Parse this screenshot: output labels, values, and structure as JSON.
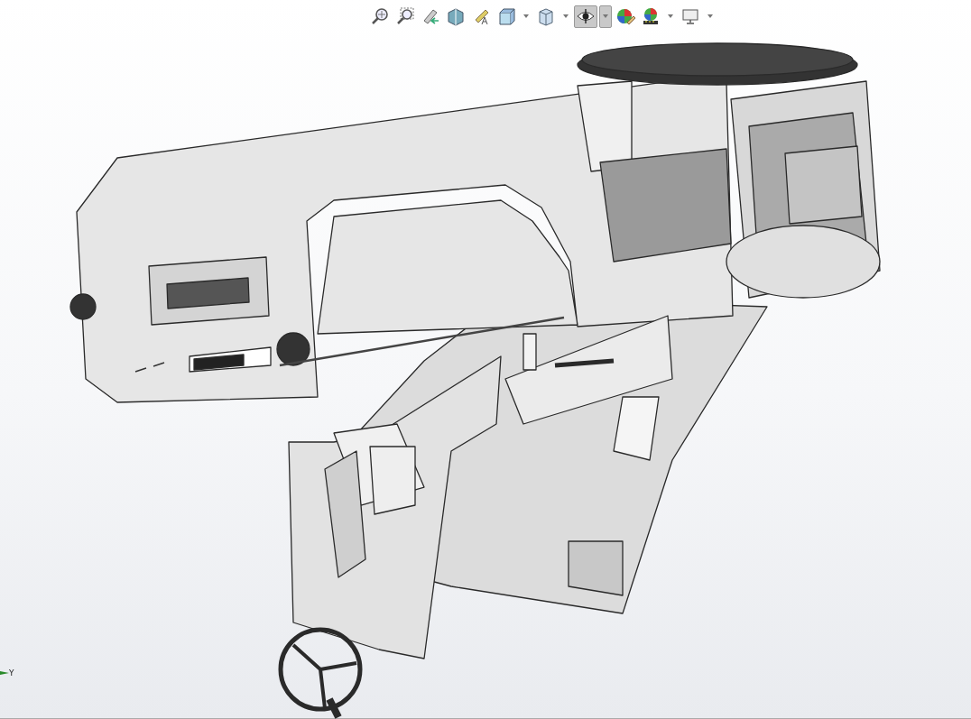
{
  "view_toolbar": [
    {
      "kind": "zoom-fit",
      "selected": false,
      "dropdown": false
    },
    {
      "kind": "zoom-area",
      "selected": false,
      "dropdown": false
    },
    {
      "kind": "previous-view",
      "selected": false,
      "dropdown": false
    },
    {
      "kind": "section-view",
      "selected": false,
      "dropdown": false
    },
    {
      "kind": "annotation-view",
      "selected": false,
      "dropdown": false
    },
    {
      "kind": "view-orientation",
      "selected": false,
      "dropdown": true
    },
    {
      "kind": "display-style",
      "selected": false,
      "dropdown": true
    },
    {
      "kind": "hide-show",
      "selected": true,
      "dropdown": true
    },
    {
      "kind": "edit-appearance",
      "selected": false,
      "dropdown": false
    },
    {
      "kind": "apply-scene",
      "selected": false,
      "dropdown": true
    },
    {
      "kind": "view-settings",
      "selected": false,
      "dropdown": true
    }
  ],
  "triad": {
    "axis_label": "Y"
  }
}
